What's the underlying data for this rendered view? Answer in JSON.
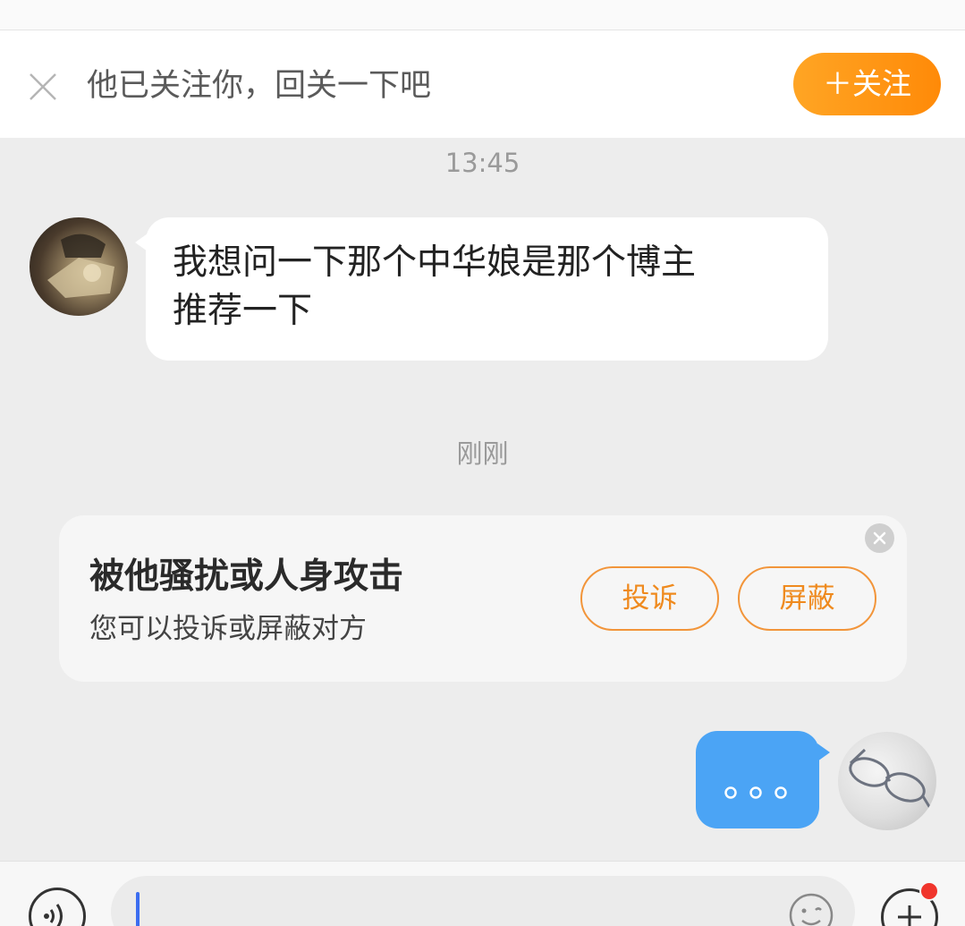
{
  "follow_bar": {
    "close_icon": "close-icon",
    "message": "他已关注你，回关一下吧",
    "follow_button": "＋关注",
    "accent_color": "#ff9a14"
  },
  "chat": {
    "timestamp_1": "13:45",
    "incoming_message": {
      "line_1": "我想问一下那个中华娘是那个博主",
      "line_2": "推荐一下"
    },
    "timestamp_2": "刚刚",
    "outgoing_message": {
      "content": "...",
      "bubble_color": "#4ba4f5"
    }
  },
  "report_card": {
    "title": "被他骚扰或人身攻击",
    "subtitle": "您可以投诉或屏蔽对方",
    "complain_button": "投诉",
    "block_button": "屏蔽",
    "dismiss_icon": "close-circle-icon",
    "button_color": "#ef8a1e"
  },
  "input_bar": {
    "voice_icon": "voice-icon",
    "input_value": "",
    "emoji_icon": "emoji-icon",
    "plus_icon": "plus-icon",
    "notification_dot_color": "#f0352c"
  }
}
